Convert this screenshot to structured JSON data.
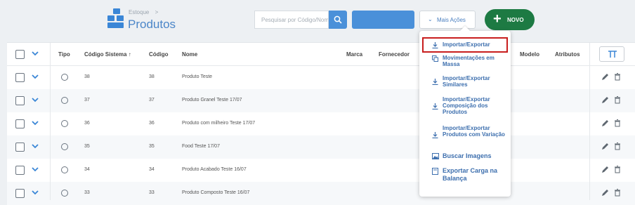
{
  "header": {
    "breadcrumb": "Estoque",
    "breadcrumb_sep": ">",
    "title": "Produtos",
    "search_placeholder": "Pesquisar por Código/Nome",
    "more_actions_label": "Mais Ações",
    "new_label": "NOVO",
    "accent": "#4a90d9",
    "new_color": "#1d7a43"
  },
  "table": {
    "columns": [
      "Tipo",
      "Código Sistema",
      "Código",
      "Nome",
      "Marca",
      "Fornecedor",
      "Modelo",
      "Atributos"
    ],
    "sort_indicator": "↑",
    "rows": [
      {
        "codigo_sistema": "38",
        "codigo": "38",
        "nome": "Produto Teste"
      },
      {
        "codigo_sistema": "37",
        "codigo": "37",
        "nome": "Produto Granel Teste 17/07"
      },
      {
        "codigo_sistema": "36",
        "codigo": "36",
        "nome": "Produto com milheiro Teste 17/07"
      },
      {
        "codigo_sistema": "35",
        "codigo": "35",
        "nome": "Food Teste 17/07"
      },
      {
        "codigo_sistema": "34",
        "codigo": "34",
        "nome": "Produto Acabado Teste 16/07"
      },
      {
        "codigo_sistema": "33",
        "codigo": "33",
        "nome": "Produto Composto Teste 16/07"
      }
    ]
  },
  "menu": {
    "items": [
      {
        "label": "Importar/Exportar",
        "icon": "download-icon"
      },
      {
        "label": "Movimentações em Massa",
        "icon": "copy-icon"
      },
      {
        "label": "Importar/Exportar Similares",
        "icon": "download-icon"
      },
      {
        "label": "Importar/Exportar Composição dos Produtos",
        "icon": "download-icon"
      },
      {
        "label": "Importar/Exportar Produtos com Variação",
        "icon": "download-icon"
      },
      {
        "label": "Buscar Imagens",
        "icon": "image-icon"
      },
      {
        "label": "Exportar Carga na Balança",
        "icon": "scale-icon"
      }
    ],
    "highlight_color": "#c81e1e"
  }
}
